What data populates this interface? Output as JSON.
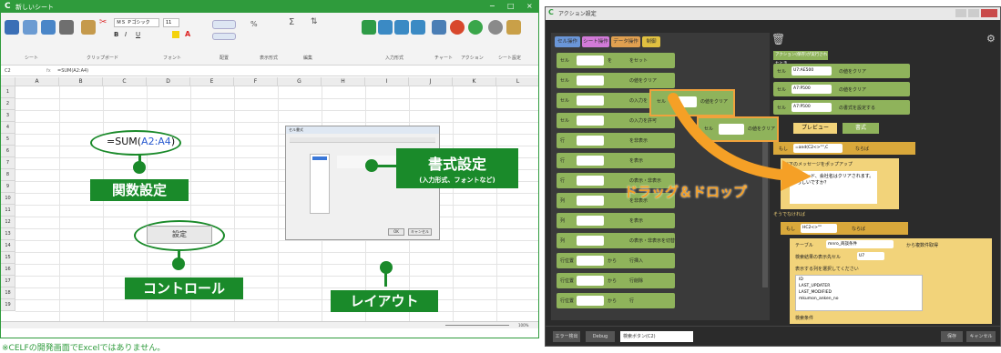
{
  "left_window": {
    "app_letter": "C",
    "title": "新しいシート",
    "win_min": "−",
    "win_max": "□",
    "win_close": "×",
    "cell_ref": "C2",
    "formula": "=SUM(A2:A4)",
    "ribbon_font": "ＭＳ Ｐゴシック",
    "ribbon_size": "11",
    "ribbon_groups": [
      "シート",
      "クリップボード",
      "フォント",
      "配置",
      "表示形式",
      "編集",
      "入力形式",
      "チャート",
      "アクション",
      "シート設定"
    ],
    "columns": [
      "A",
      "B",
      "C",
      "D",
      "E",
      "F",
      "G",
      "H",
      "I",
      "J",
      "K",
      "L"
    ],
    "rows": [
      "1",
      "2",
      "3",
      "4",
      "5",
      "6",
      "7",
      "8",
      "9",
      "10",
      "11",
      "12",
      "13",
      "14",
      "15",
      "16",
      "17",
      "18",
      "19"
    ],
    "formula_demo": "=SUM(",
    "formula_demo_ref": "A2:A4",
    "formula_demo_end": ")",
    "label_function": "関数設定",
    "label_format": "書式設定",
    "label_format_sub": "(入力形式、フォントなど)",
    "button_setting": "設定",
    "label_control": "コントロール",
    "label_layout": "レイアウト",
    "dialog_title": "セル書式",
    "dialog_ok": "OK",
    "dialog_cancel": "キャンセル",
    "zoom": "100%"
  },
  "note": "※CELFの開発画面でExcelではありません。",
  "right_window": {
    "app_letter": "C",
    "title": "アクション設定",
    "tabs": [
      "セル操作",
      "シート操作",
      "データ操作",
      "制御"
    ],
    "palette_items": [
      {
        "a": "セル",
        "b": "を",
        "c": "をセット"
      },
      {
        "a": "セル",
        "b": "",
        "c": "の値をクリア"
      },
      {
        "a": "セル",
        "b": "",
        "c": "の入力を"
      },
      {
        "a": "セル",
        "b": "",
        "c": "の入力を許可"
      },
      {
        "a": "行",
        "b": "",
        "c": "を非表示"
      },
      {
        "a": "行",
        "b": "",
        "c": "を表示"
      },
      {
        "a": "行",
        "b": "",
        "c": "の表示・非表示"
      },
      {
        "a": "列",
        "b": "",
        "c": "を非表示"
      },
      {
        "a": "列",
        "b": "",
        "c": "を表示"
      },
      {
        "a": "列",
        "b": "",
        "c": "の表示・非表示を切替"
      },
      {
        "a": "行位置",
        "b": "から",
        "c": "行挿入"
      },
      {
        "a": "行位置",
        "b": "から",
        "c": "行削除"
      },
      {
        "a": "行位置",
        "b": "から",
        "c": "行"
      }
    ],
    "floating_1": {
      "a": "セル",
      "c": "の値をクリア"
    },
    "floating_2": {
      "a": "セル",
      "c": "の値をクリア"
    },
    "action_header": "アクション(保存)が実行されたとき",
    "action_rows": [
      {
        "a": "セル",
        "v": "U7:AE500",
        "c": "の値をクリア"
      },
      {
        "a": "セル",
        "v": "A7:P500",
        "c": "の値をクリア"
      },
      {
        "a": "セル",
        "v": "A7:P500",
        "c": "の書式を設定する"
      }
    ],
    "preview_btn": "プレビュー",
    "format_btn": "書式",
    "if_row": {
      "a": "もし",
      "v": "=and(C2<>\"\",C",
      "c": "ならば"
    },
    "popup_label": "以下のメッセージをポップアップ",
    "popup_text": "会社コード、会社名はクリアされます。よろしいですか？",
    "else_label": "そうでなければ",
    "if2_row": {
      "a": "もし",
      "v": "HC2<>\"\"",
      "c": "ならば"
    },
    "table_label": "テーブル",
    "table_value": "mnro_商談条件",
    "table_suffix": "から複数件取得",
    "dest_label": "検索結果の表示先セル",
    "dest_value": "U7",
    "cols_label": "表示する列を選択してください",
    "col_options": [
      "ID",
      "LAST_UPDATER",
      "LAST_MODIFIED",
      "mkumon_anken_no"
    ],
    "cond_label": "検索条件",
    "drag_label": "ドラッグ＆ドロップ",
    "footer_left": "エラー検出",
    "footer_debug": "Debug",
    "footer_select": "検索ボタン(C2)",
    "footer_save": "保存",
    "footer_cancel": "キャンセル",
    "trash_icon": "trash-icon",
    "gear_icon": "gear-icon"
  },
  "colors": {
    "green": "#1a8a2a",
    "block_green": "#8fb35b",
    "orange": "#f0a23c",
    "dark": "#2b2b2b"
  }
}
